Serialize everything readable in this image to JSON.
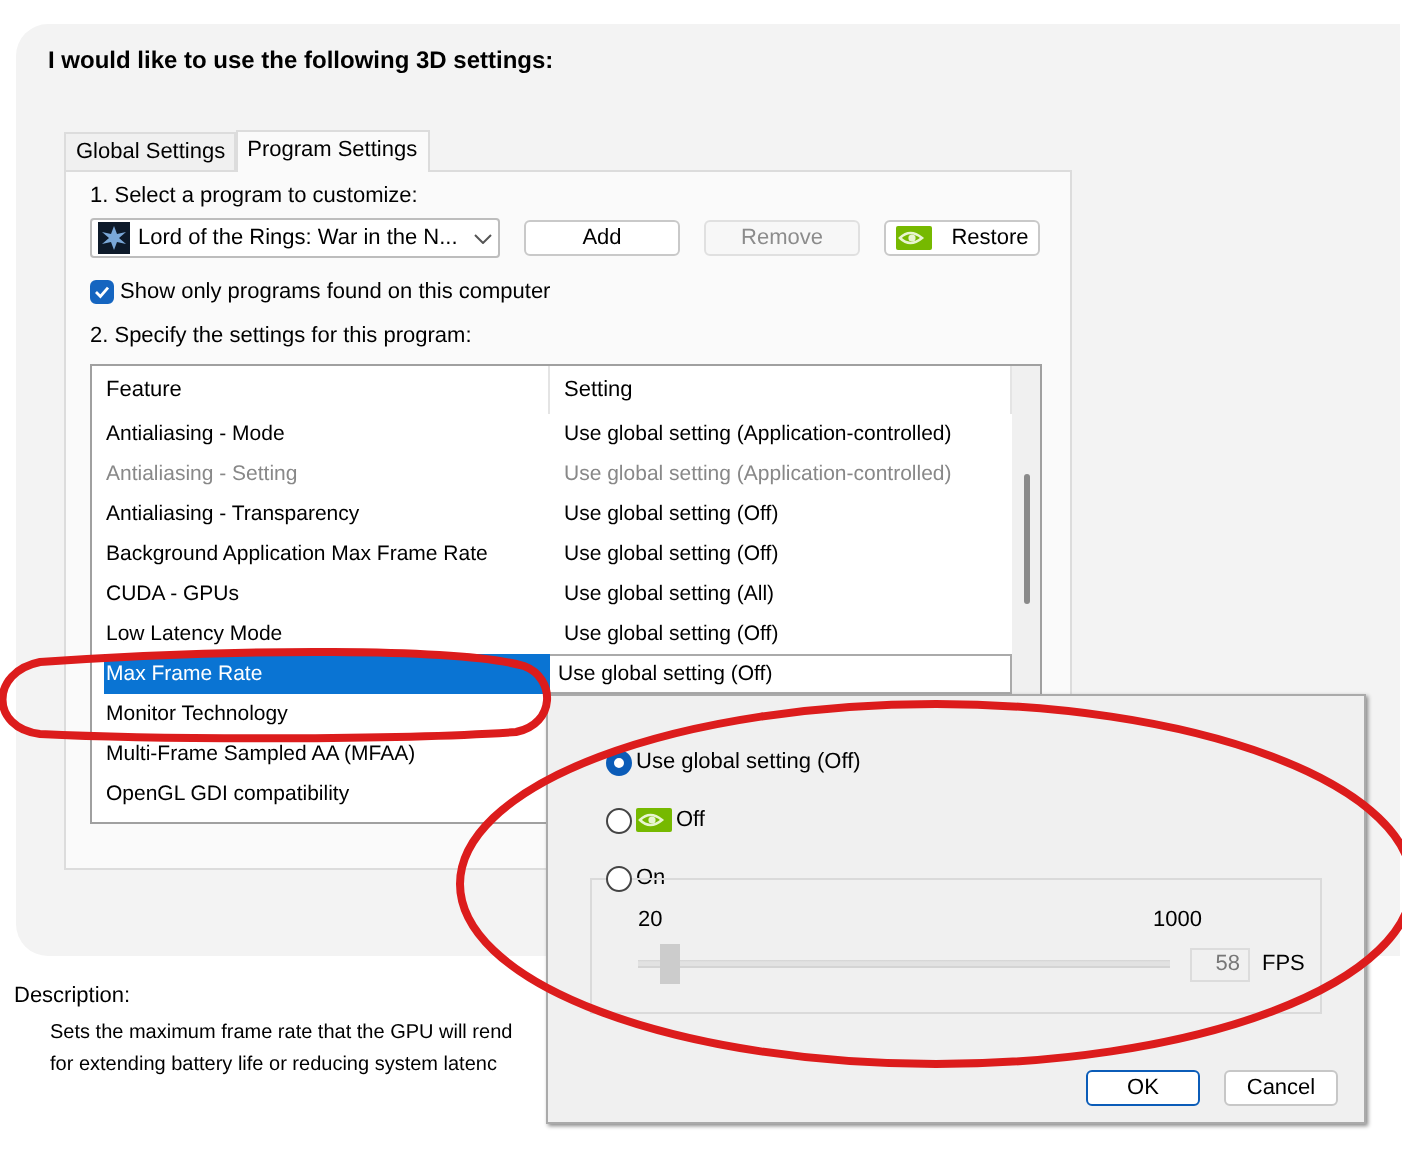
{
  "heading": "I would like to use the following 3D settings:",
  "tabs": [
    {
      "label": "Global Settings",
      "selected": false
    },
    {
      "label": "Program Settings",
      "selected": true
    }
  ],
  "step1_label": "1. Select a program to customize:",
  "program_select": {
    "value": "Lord of the Rings: War in the N..."
  },
  "buttons": [
    {
      "label": "Add",
      "disabled": false,
      "kind": "plain"
    },
    {
      "label": "Remove",
      "disabled": true,
      "kind": "plain"
    },
    {
      "label": "Restore",
      "disabled": false,
      "kind": "logo"
    }
  ],
  "show_only_checkbox": {
    "label": "Show only programs found on this computer",
    "checked": true
  },
  "step2_label": "2. Specify the settings for this program:",
  "table": {
    "columns": [
      "Feature",
      "Setting"
    ],
    "rows": [
      {
        "feature": "Antialiasing - Mode",
        "setting": "Use global setting (Application-controlled)",
        "disabled": false,
        "selected": false
      },
      {
        "feature": "Antialiasing - Setting",
        "setting": "Use global setting (Application-controlled)",
        "disabled": true,
        "selected": false
      },
      {
        "feature": "Antialiasing - Transparency",
        "setting": "Use global setting (Off)",
        "disabled": false,
        "selected": false
      },
      {
        "feature": "Background Application Max Frame Rate",
        "setting": "Use global setting (Off)",
        "disabled": false,
        "selected": false
      },
      {
        "feature": "CUDA - GPUs",
        "setting": "Use global setting (All)",
        "disabled": false,
        "selected": false
      },
      {
        "feature": "Low Latency Mode",
        "setting": "Use global setting (Off)",
        "disabled": false,
        "selected": false
      },
      {
        "feature": "Max Frame Rate",
        "setting": "Use global setting (Off)",
        "disabled": false,
        "selected": true
      },
      {
        "feature": "Monitor Technology",
        "disabled": false,
        "selected": false
      },
      {
        "feature": "Multi-Frame Sampled AA (MFAA)",
        "disabled": false,
        "selected": false
      },
      {
        "feature": "OpenGL GDI compatibility",
        "disabled": false,
        "selected": false
      }
    ]
  },
  "description": {
    "label": "Description:",
    "lines": [
      "Sets the maximum frame rate that the GPU will rend",
      "for extending battery life or reducing system latenc"
    ]
  },
  "popup": {
    "options": [
      {
        "label": "Use global setting (Off)",
        "selected": true,
        "kind": "plain"
      },
      {
        "label": "Off",
        "selected": false,
        "kind": "logo"
      },
      {
        "label": "On",
        "selected": false,
        "kind": "group"
      }
    ],
    "slider": {
      "min_label": "20",
      "max_label": "1000",
      "level": 0.04,
      "disabled": true
    },
    "fps_field": {
      "value": "58",
      "disabled": true
    },
    "unit": "FPS",
    "buttons": [
      {
        "label": "OK",
        "default": true
      },
      {
        "label": "Cancel",
        "default": false
      }
    ]
  },
  "annotations": [
    {
      "kind": "ellipse"
    },
    {
      "kind": "ellipse"
    }
  ]
}
